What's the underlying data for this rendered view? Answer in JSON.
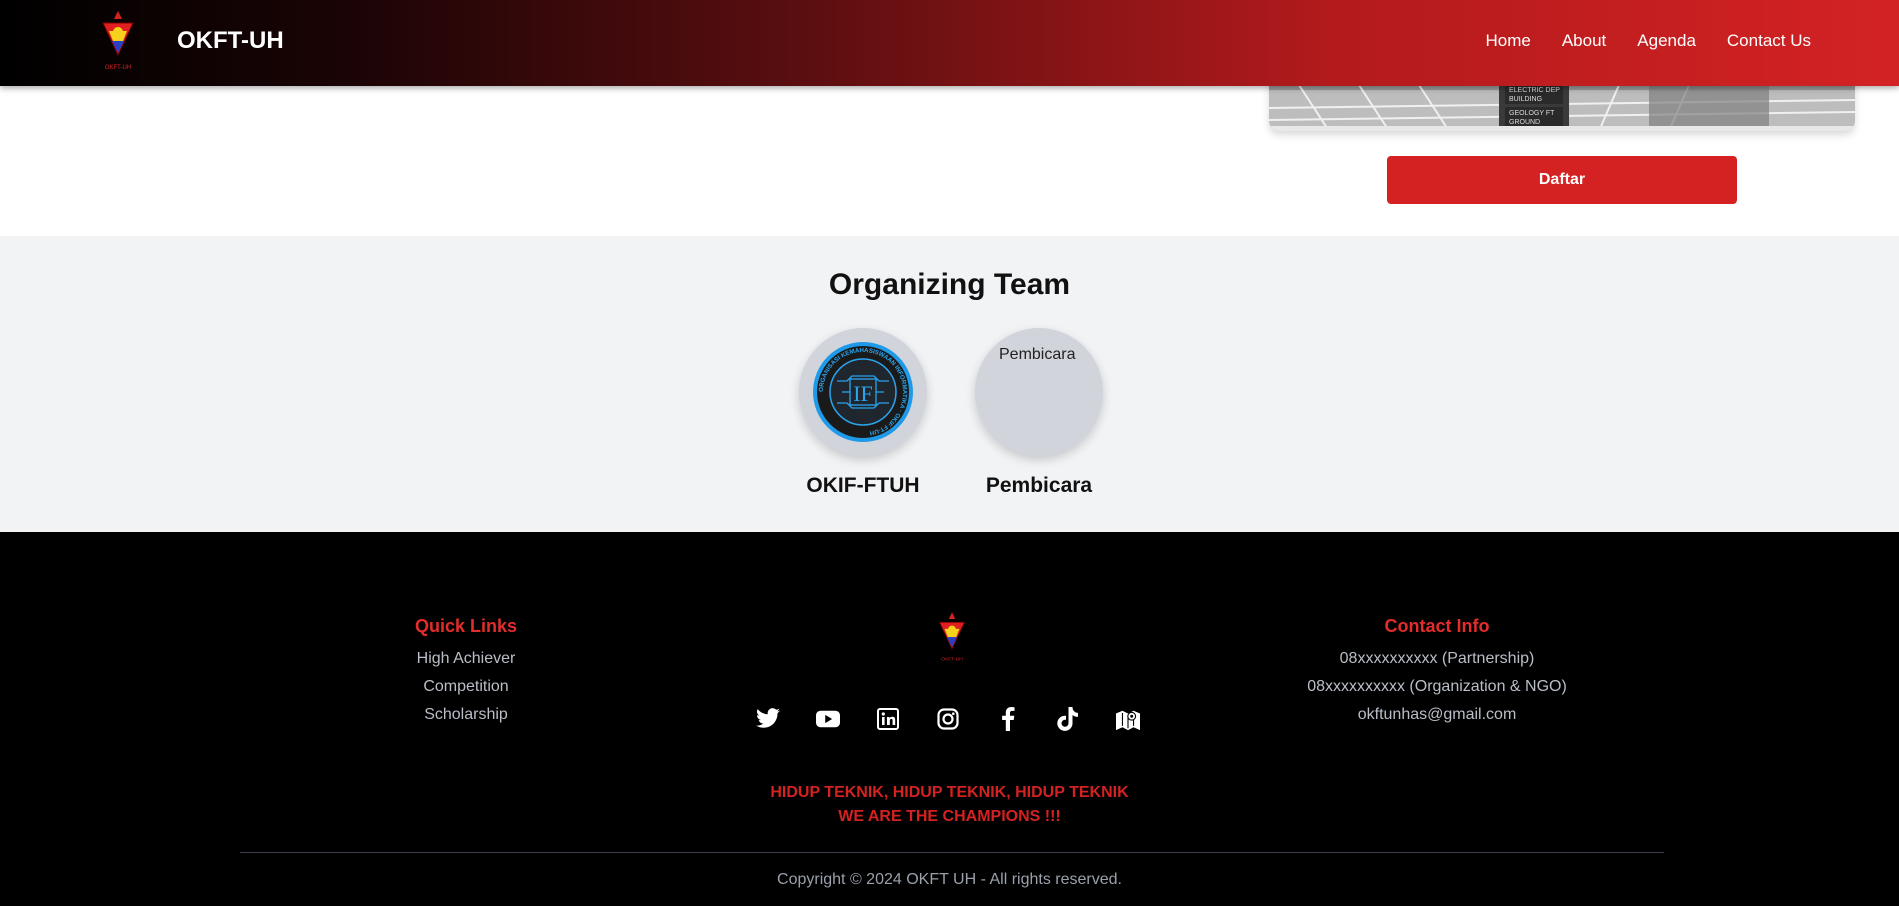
{
  "header": {
    "brand": "OKFT-UH",
    "logo_caption": "OKFT-UH",
    "nav": [
      "Home",
      "About",
      "Agenda",
      "Contact Us"
    ]
  },
  "event": {
    "image_signs": [
      "ELECTRIC DEP",
      "BUILDING",
      "GEOLOGY FT",
      "GROUND"
    ],
    "register_label": "Daftar"
  },
  "team": {
    "title": "Organizing Team",
    "members": [
      {
        "name": "OKIF-FTUH",
        "emblem_letters": "IF",
        "emblem_ring_text": "ORGANISASI KEMAHASISWAAN INFORMATIKA · OKIF FT-UH"
      },
      {
        "name": "Pembicara",
        "image_alt": "Pembicara"
      }
    ]
  },
  "footer": {
    "quick_links": {
      "title": "Quick Links",
      "items": [
        "High Achiever",
        "Competition",
        "Scholarship"
      ]
    },
    "logo_caption": "OKFT-UH",
    "socials": [
      "twitter-icon",
      "youtube-icon",
      "linkedin-icon",
      "instagram-icon",
      "facebook-icon",
      "tiktok-icon",
      "map-icon"
    ],
    "contact": {
      "title": "Contact Info",
      "items": [
        "08xxxxxxxxxx (Partnership)",
        "08xxxxxxxxxx (Organization & NGO)",
        "okftunhas@gmail.com"
      ]
    },
    "slogan_line1": "HIDUP TEKNIK, HIDUP TEKNIK, HIDUP TEKNIK",
    "slogan_line2": "WE ARE THE CHAMPIONS !!!",
    "copyright": "Copyright © 2024 OKFT UH - All rights reserved."
  },
  "colors": {
    "accent": "#d42121",
    "footer_bg": "#000000",
    "team_bg": "#f2f3f5"
  }
}
